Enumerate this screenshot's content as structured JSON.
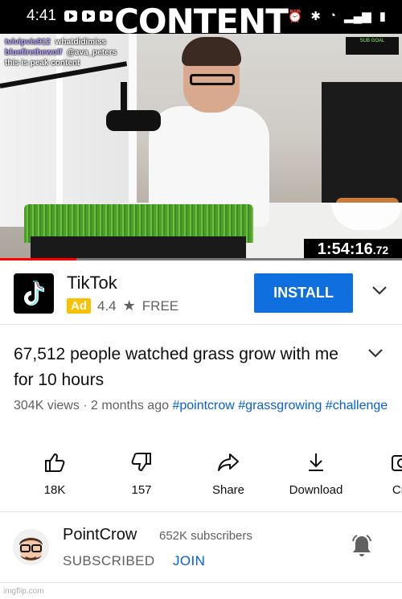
{
  "status_bar": {
    "time": "4:41"
  },
  "meme": {
    "caption": "CONTENT"
  },
  "video": {
    "chat": [
      {
        "user": "tvivipvis912",
        "message": "whatdidimiss"
      },
      {
        "user": "bluefirethewolf",
        "message": "@ava_peters"
      },
      {
        "user": "",
        "message": "this is peak content"
      }
    ],
    "sub_goal": "SUB GOAL",
    "timer_main": "1:54:16",
    "timer_ms": ".72",
    "progress_fraction": 0.19
  },
  "ad": {
    "app_name": "TikTok",
    "badge": "Ad",
    "rating": "4.4",
    "price": "FREE",
    "install_label": "INSTALL"
  },
  "video_info": {
    "title": "67,512 people watched grass grow with me for 10 hours",
    "views": "304K views",
    "age": "2 months ago",
    "hashtags": [
      "#pointcrow",
      "#grassgrowing",
      "#challenge"
    ]
  },
  "actions": [
    {
      "icon": "thumbs-up-icon",
      "label": "18K"
    },
    {
      "icon": "thumbs-down-icon",
      "label": "157"
    },
    {
      "icon": "share-icon",
      "label": "Share"
    },
    {
      "icon": "download-icon",
      "label": "Download"
    },
    {
      "icon": "create-icon",
      "label": "Cre"
    }
  ],
  "channel": {
    "name": "PointCrow",
    "subscribers": "652K subscribers",
    "subscribed_label": "SUBSCRIBED",
    "join_label": "JOIN"
  },
  "watermark": "imgflip.com",
  "colors": {
    "accent_blue": "#065fd4",
    "install_blue": "#0f6fde",
    "ad_yellow": "#f9c100",
    "progress_red": "#ff0000"
  }
}
